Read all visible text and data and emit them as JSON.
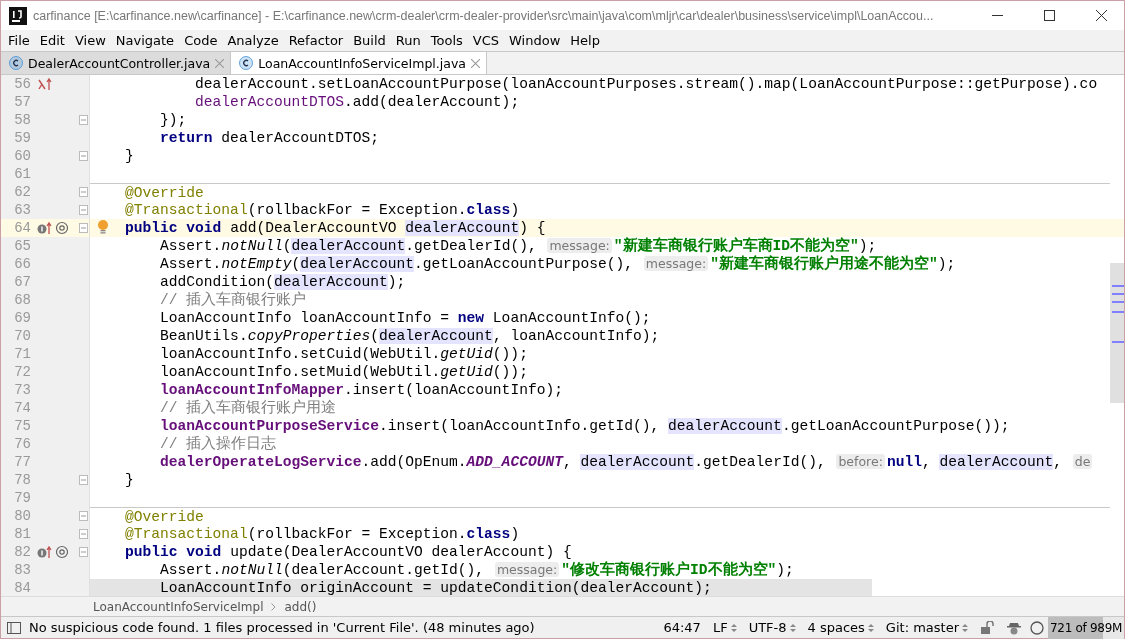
{
  "window": {
    "title": "carfinance [E:\\carfinance.new\\carfinance] - E:\\carfinance.new\\crm-dealer\\crm-dealer-provider\\src\\main\\java\\com\\mljr\\car\\dealer\\business\\service\\impl\\LoanAccou..."
  },
  "menu": [
    "File",
    "Edit",
    "View",
    "Navigate",
    "Code",
    "Analyze",
    "Refactor",
    "Build",
    "Run",
    "Tools",
    "VCS",
    "Window",
    "Help"
  ],
  "tabs": [
    {
      "label": "DealerAccountController.java",
      "selected": false
    },
    {
      "label": "LoanAccountInfoServiceImpl.java",
      "selected": true
    }
  ],
  "editor": {
    "lines": [
      {
        "number": "56",
        "lambda_marker": true,
        "tokens": [
          {
            "kind": "plain",
            "text": "            dealerAccount.setLoanAccountPurpose(loanAccountPurposes.stream().map(LoanAccountPurpose::getPurpose).co"
          }
        ]
      },
      {
        "number": "57",
        "tokens": [
          {
            "kind": "var",
            "text": "            dealerAccountDTOS"
          },
          {
            "kind": "plain",
            "text": ".add(dealerAccount);"
          }
        ]
      },
      {
        "number": "58",
        "fold": true,
        "tokens": [
          {
            "kind": "plain",
            "text": "        });"
          }
        ]
      },
      {
        "number": "59",
        "tokens": [
          {
            "kind": "keyword",
            "text": "        return"
          },
          {
            "kind": "plain",
            "text": " dealerAccountDTOS;"
          }
        ]
      },
      {
        "number": "60",
        "fold": true,
        "tokens": [
          {
            "kind": "plain",
            "text": "    }"
          }
        ]
      },
      {
        "number": "61"
      },
      {
        "number": "62",
        "fold": true,
        "separator": true,
        "tokens": [
          {
            "kind": "annotation",
            "text": "    @Override"
          }
        ]
      },
      {
        "number": "63",
        "fold": true,
        "tokens": [
          {
            "kind": "annotation",
            "text": "    @Transactional"
          },
          {
            "kind": "plain",
            "text": "(rollbackFor = Exception."
          },
          {
            "kind": "keyword",
            "text": "class"
          },
          {
            "kind": "plain",
            "text": ")"
          }
        ]
      },
      {
        "number": "64",
        "fold": true,
        "current": true,
        "intention": true,
        "implements_marker": true,
        "tokens": [
          {
            "kind": "keyword",
            "text": "    public void"
          },
          {
            "kind": "plain",
            "text": " add(DealerAccountVO "
          },
          {
            "kind": "usage",
            "text": "dealerAccount"
          },
          {
            "kind": "plain",
            "text": ") {"
          }
        ]
      },
      {
        "number": "65",
        "tokens": [
          {
            "kind": "plain",
            "text": "        Assert."
          },
          {
            "kind": "static",
            "text": "notNull"
          },
          {
            "kind": "plain",
            "text": "("
          },
          {
            "kind": "usage",
            "text": "dealerAccount"
          },
          {
            "kind": "plain",
            "text": ".getDealerId(), "
          },
          {
            "kind": "hint",
            "text": "message:"
          },
          {
            "kind": "string",
            "text": "\"新建车商银行账户车商ID不能为空\""
          },
          {
            "kind": "plain",
            "text": ");"
          }
        ]
      },
      {
        "number": "66",
        "tokens": [
          {
            "kind": "plain",
            "text": "        Assert."
          },
          {
            "kind": "static",
            "text": "notEmpty"
          },
          {
            "kind": "plain",
            "text": "("
          },
          {
            "kind": "usage",
            "text": "dealerAccount"
          },
          {
            "kind": "plain",
            "text": ".getLoanAccountPurpose(), "
          },
          {
            "kind": "hint",
            "text": "message:"
          },
          {
            "kind": "string",
            "text": "\"新建车商银行账户用途不能为空\""
          },
          {
            "kind": "plain",
            "text": ");"
          }
        ]
      },
      {
        "number": "67",
        "tokens": [
          {
            "kind": "plain",
            "text": "        addCondition("
          },
          {
            "kind": "usage",
            "text": "dealerAccount"
          },
          {
            "kind": "plain",
            "text": ");"
          }
        ]
      },
      {
        "number": "68",
        "tokens": [
          {
            "kind": "comment",
            "text": "        // 插入车商银行账户"
          }
        ]
      },
      {
        "number": "69",
        "tokens": [
          {
            "kind": "plain",
            "text": "        LoanAccountInfo loanAccountInfo = "
          },
          {
            "kind": "keyword",
            "text": "new"
          },
          {
            "kind": "plain",
            "text": " LoanAccountInfo();"
          }
        ]
      },
      {
        "number": "70",
        "tokens": [
          {
            "kind": "plain",
            "text": "        BeanUtils."
          },
          {
            "kind": "static",
            "text": "copyProperties"
          },
          {
            "kind": "plain",
            "text": "("
          },
          {
            "kind": "usage",
            "text": "dealerAccount"
          },
          {
            "kind": "plain",
            "text": ", loanAccountInfo);"
          }
        ]
      },
      {
        "number": "71",
        "tokens": [
          {
            "kind": "plain",
            "text": "        loanAccountInfo.setCuid(WebUtil."
          },
          {
            "kind": "static",
            "text": "getUid"
          },
          {
            "kind": "plain",
            "text": "());"
          }
        ]
      },
      {
        "number": "72",
        "tokens": [
          {
            "kind": "plain",
            "text": "        loanAccountInfo.setMuid(WebUtil."
          },
          {
            "kind": "static",
            "text": "getUid"
          },
          {
            "kind": "plain",
            "text": "());"
          }
        ]
      },
      {
        "number": "73",
        "tokens": [
          {
            "kind": "field",
            "text": "        loanAccountInfoMapper"
          },
          {
            "kind": "plain",
            "text": ".insert(loanAccountInfo);"
          }
        ]
      },
      {
        "number": "74",
        "tokens": [
          {
            "kind": "comment",
            "text": "        // 插入车商银行账户用途"
          }
        ]
      },
      {
        "number": "75",
        "tokens": [
          {
            "kind": "field",
            "text": "        loanAccountPurposeService"
          },
          {
            "kind": "plain",
            "text": ".insert(loanAccountInfo.getId(), "
          },
          {
            "kind": "usage",
            "text": "dealerAccount"
          },
          {
            "kind": "plain",
            "text": ".getLoanAccountPurpose());"
          }
        ]
      },
      {
        "number": "76",
        "tokens": [
          {
            "kind": "comment",
            "text": "        // 插入操作日志"
          }
        ]
      },
      {
        "number": "77",
        "tokens": [
          {
            "kind": "field",
            "text": "        dealerOperateLogService"
          },
          {
            "kind": "plain",
            "text": ".add(OpEnum."
          },
          {
            "kind": "static_field",
            "text": "ADD_ACCOUNT"
          },
          {
            "kind": "plain",
            "text": ", "
          },
          {
            "kind": "usage",
            "text": "dealerAccount"
          },
          {
            "kind": "plain",
            "text": ".getDealerId(), "
          },
          {
            "kind": "hint",
            "text": "before:"
          },
          {
            "kind": "keyword",
            "text": "null"
          },
          {
            "kind": "plain",
            "text": ", "
          },
          {
            "kind": "usage",
            "text": "dealerAccount"
          },
          {
            "kind": "plain",
            "text": ", "
          },
          {
            "kind": "hint",
            "text": "de"
          }
        ]
      },
      {
        "number": "78",
        "fold": true,
        "tokens": [
          {
            "kind": "plain",
            "text": "    }"
          }
        ]
      },
      {
        "number": "79"
      },
      {
        "number": "80",
        "fold": true,
        "separator": true,
        "tokens": [
          {
            "kind": "annotation",
            "text": "    @Override"
          }
        ]
      },
      {
        "number": "81",
        "fold": true,
        "tokens": [
          {
            "kind": "annotation",
            "text": "    @Transactional"
          },
          {
            "kind": "plain",
            "text": "(rollbackFor = Exception."
          },
          {
            "kind": "keyword",
            "text": "class"
          },
          {
            "kind": "plain",
            "text": ")"
          }
        ]
      },
      {
        "number": "82",
        "fold": true,
        "implements_marker": true,
        "tokens": [
          {
            "kind": "keyword",
            "text": "    public void"
          },
          {
            "kind": "plain",
            "text": " update(DealerAccountVO dealerAccount) {"
          }
        ]
      },
      {
        "number": "83",
        "tokens": [
          {
            "kind": "plain",
            "text": "        Assert."
          },
          {
            "kind": "static",
            "text": "notNull"
          },
          {
            "kind": "plain",
            "text": "(dealerAccount.getId(), "
          },
          {
            "kind": "hint",
            "text": "message:"
          },
          {
            "kind": "string",
            "text": "\"修改车商银行账户ID不能为空\""
          },
          {
            "kind": "plain",
            "text": ");"
          }
        ]
      },
      {
        "number": "84",
        "shaded": true,
        "tokens": [
          {
            "kind": "plain",
            "text": "        LoanAccountInfo originAccount = updateCondition(dealerAccount);"
          }
        ]
      }
    ]
  },
  "breadcrumb": [
    "LoanAccountInfoServiceImpl",
    "add()"
  ],
  "status_bar": {
    "message": "No suspicious code found. 1 files processed in 'Current File'. (48 minutes ago)",
    "items": [
      {
        "text": "64:47",
        "kind": "plain"
      },
      {
        "text": "LF",
        "kind": "dropdown"
      },
      {
        "text": "UTF-8",
        "kind": "dropdown"
      },
      {
        "text": "4 spaces",
        "kind": "dropdown"
      },
      {
        "text": "Git: master",
        "kind": "dropdown"
      }
    ],
    "memory": {
      "text": "721 of 989M",
      "level": 0.73
    }
  }
}
